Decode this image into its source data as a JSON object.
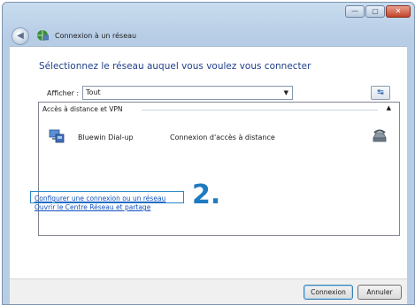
{
  "window": {
    "title": "Connexion à un réseau",
    "caption_buttons": {
      "minimize": "—",
      "maximize": "▢",
      "close": "✕"
    }
  },
  "nav": {
    "back_glyph": "◀"
  },
  "main": {
    "heading": "Sélectionnez le réseau auquel vous voulez vous connecter",
    "filter": {
      "label": "Afficher :",
      "value": "Tout"
    },
    "refresh_glyph": "↹"
  },
  "list": {
    "group_header": "Accès à distance et VPN",
    "collapse_glyph": "▲",
    "items": [
      {
        "name": "Bluewin Dial-up",
        "type": "Connexion d'accès à distance"
      }
    ]
  },
  "links": {
    "configure": "Configurer une connexion ou un réseau",
    "network_center": "Ouvrir le Centre Réseau et partage"
  },
  "annotation": {
    "step": "2."
  },
  "footer": {
    "connect_label": "Connexion",
    "cancel_label": "Annuler"
  },
  "colors": {
    "link": "#1150c0",
    "heading": "#1f3f8a",
    "annotation": "#1f7bc1"
  }
}
